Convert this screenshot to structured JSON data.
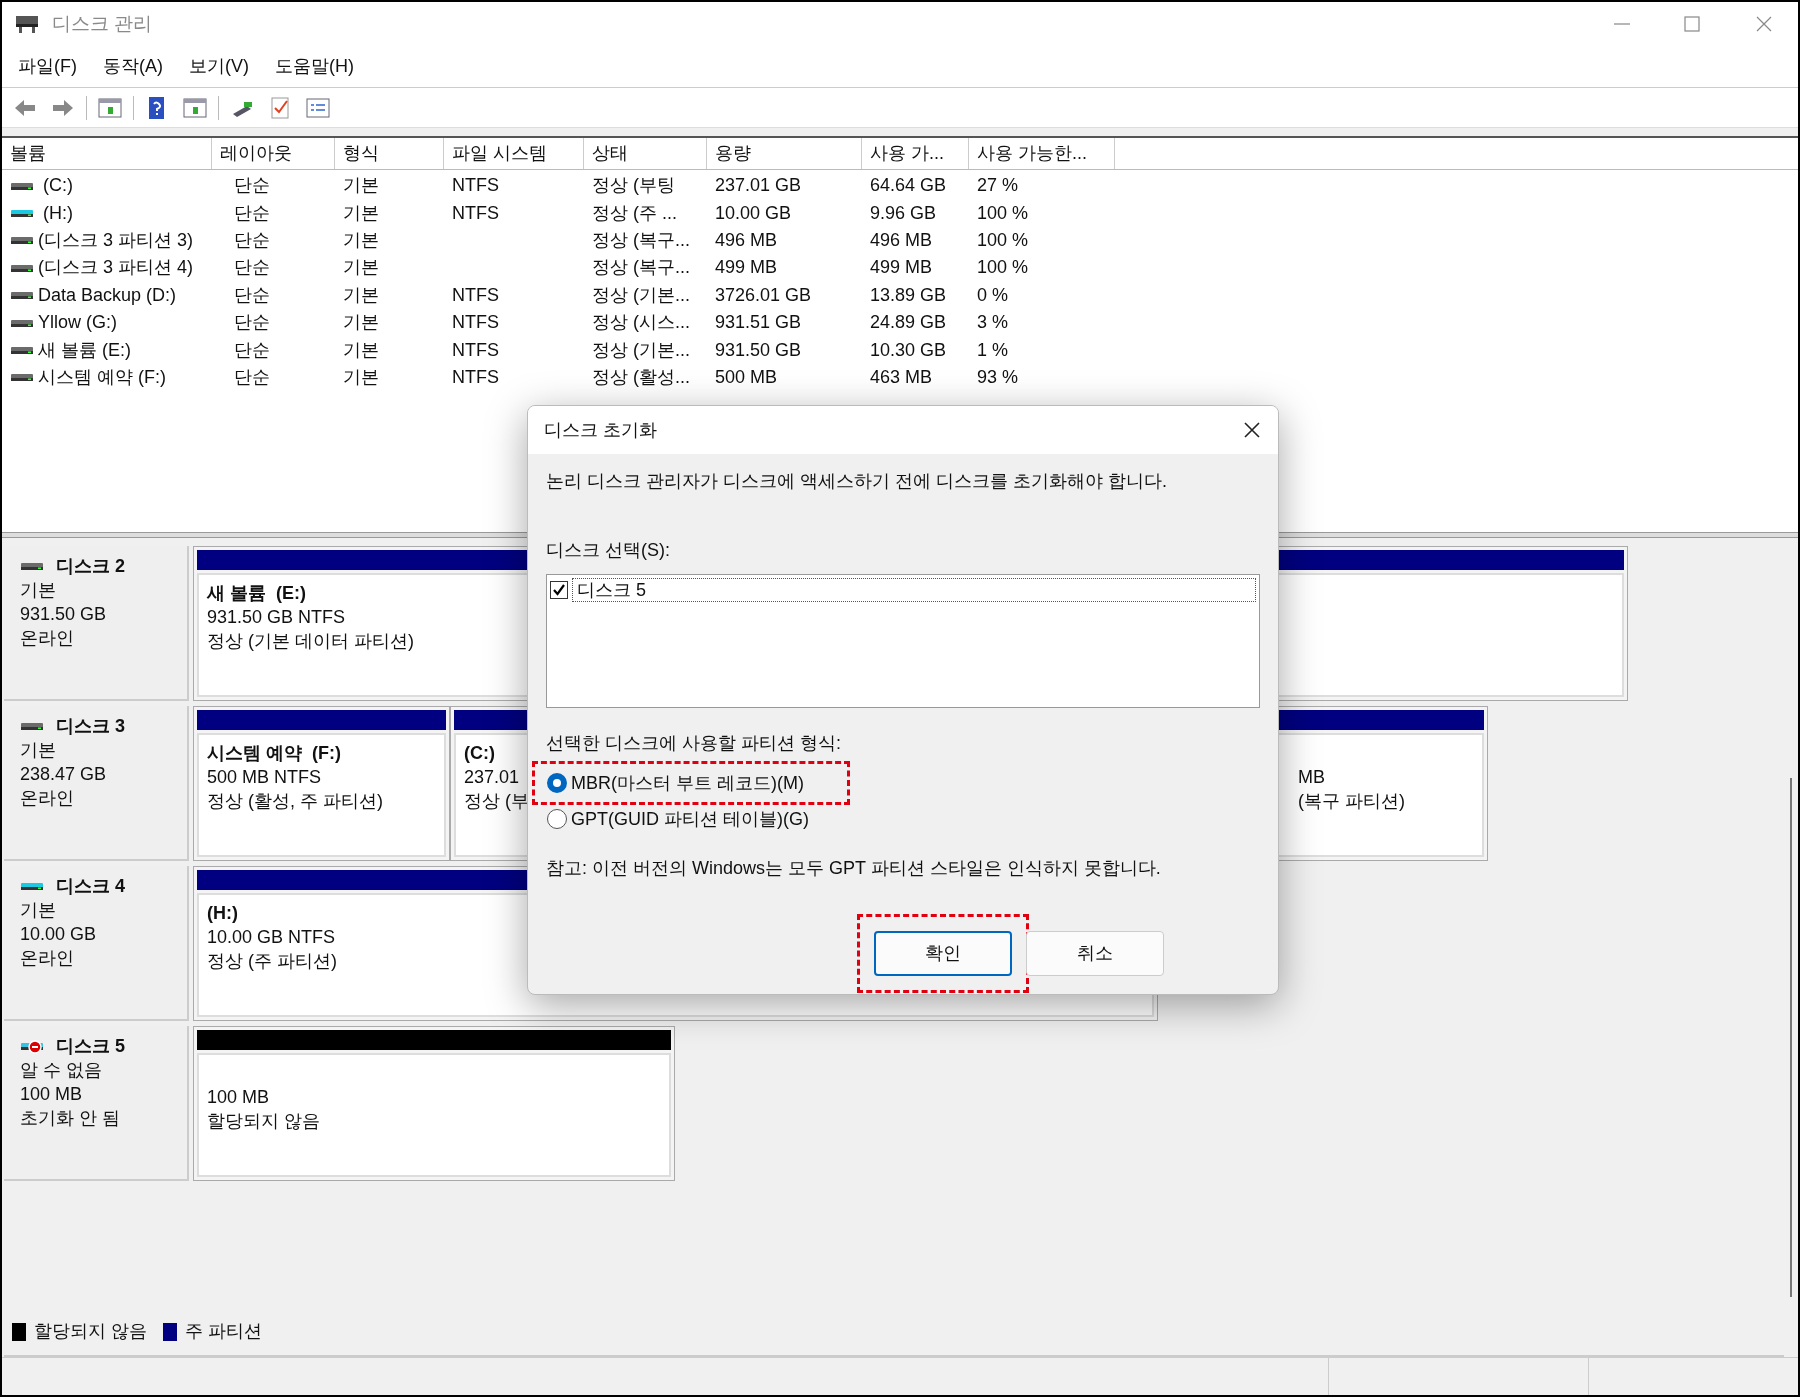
{
  "window": {
    "title": "디스크 관리"
  },
  "menu": [
    "파일(F)",
    "동작(A)",
    "보기(V)",
    "도움말(H)"
  ],
  "volume_table": {
    "columns": [
      "볼륨",
      "레이아웃",
      "형식",
      "파일 시스템",
      "상태",
      "용량",
      "사용 가...",
      "사용 가능한..."
    ],
    "rows": [
      {
        "kind": "fixed",
        "cells": [
          " (C:)",
          "단순",
          "기본",
          "NTFS",
          "정상 (부팅",
          "237.01 GB",
          "64.64 GB",
          "27 %"
        ]
      },
      {
        "kind": "removable",
        "cells": [
          " (H:)",
          "단순",
          "기본",
          "NTFS",
          "정상 (주 ...",
          "10.00 GB",
          "9.96 GB",
          "100 %"
        ]
      },
      {
        "kind": "fixed",
        "cells": [
          "(디스크 3 파티션 3)",
          "단순",
          "기본",
          "",
          "정상 (복구...",
          "496 MB",
          "496 MB",
          "100 %"
        ]
      },
      {
        "kind": "fixed",
        "cells": [
          "(디스크 3 파티션 4)",
          "단순",
          "기본",
          "",
          "정상 (복구...",
          "499 MB",
          "499 MB",
          "100 %"
        ]
      },
      {
        "kind": "fixed",
        "cells": [
          "Data Backup (D:)",
          "단순",
          "기본",
          "NTFS",
          "정상 (기본...",
          "3726.01 GB",
          "13.89 GB",
          "0 %"
        ]
      },
      {
        "kind": "fixed",
        "cells": [
          "Yllow (G:)",
          "단순",
          "기본",
          "NTFS",
          "정상 (시스...",
          "931.51 GB",
          "24.89 GB",
          "3 %"
        ]
      },
      {
        "kind": "fixed",
        "cells": [
          "새 볼륨 (E:)",
          "단순",
          "기본",
          "NTFS",
          "정상 (기본...",
          "931.50 GB",
          "10.30 GB",
          "1 %"
        ]
      },
      {
        "kind": "fixed",
        "cells": [
          "시스템 예약 (F:)",
          "단순",
          "기본",
          "NTFS",
          "정상 (활성...",
          "500 MB",
          "463 MB",
          "93 %"
        ]
      }
    ]
  },
  "disks": [
    {
      "kind": "fixed",
      "name": "디스크 2",
      "type": "기본",
      "size": "931.50 GB",
      "status": "온라인",
      "partitions": [
        {
          "color": "#000080",
          "name": "새 볼륨  (E:)",
          "size": "931.50 GB NTFS",
          "status": "정상 (기본 데이터 파티션)"
        }
      ]
    },
    {
      "kind": "fixed",
      "name": "디스크 3",
      "type": "기본",
      "size": "238.47 GB",
      "status": "온라인",
      "partitions": [
        {
          "color": "#000080",
          "name": "시스템 예약  (F:)",
          "size": "500 MB NTFS",
          "status": "정상 (활성, 주 파티션)"
        },
        {
          "color": "#000080",
          "name": "(C:)",
          "size": "237.01",
          "status": "정상 (부"
        },
        {
          "color": "#000080",
          "size": "MB",
          "status": "(복구 파티션)"
        }
      ]
    },
    {
      "kind": "removable",
      "name": "디스크 4",
      "type": "기본",
      "size": "10.00 GB",
      "status": "온라인",
      "partitions": [
        {
          "color": "#000080",
          "name": "(H:)",
          "size": "10.00 GB NTFS",
          "status": "정상 (주 파티션)"
        }
      ]
    },
    {
      "kind": "unknown",
      "name": "디스크 5",
      "type": "알 수 없음",
      "size": "100 MB",
      "status": "초기화 안 됨",
      "partitions": [
        {
          "color": "#000000",
          "size": "100 MB",
          "status": "할당되지 않음"
        }
      ]
    }
  ],
  "legend": [
    {
      "color": "#000000",
      "label": "할당되지 않음"
    },
    {
      "color": "#000080",
      "label": "주 파티션"
    }
  ],
  "dialog": {
    "title": "디스크 초기화",
    "message": "논리 디스크 관리자가 디스크에 액세스하기 전에 디스크를 초기화해야 합니다.",
    "disk_select_label": "디스크 선택(S):",
    "disk_list": [
      {
        "label": "디스크 5",
        "checked": true
      }
    ],
    "partition_style_label": "선택한 디스크에 사용할 파티션 형식:",
    "options": [
      {
        "label": "MBR(마스터 부트 레코드)(M)",
        "selected": true,
        "highlighted": true
      },
      {
        "label": "GPT(GUID 파티션 테이블)(G)",
        "selected": false,
        "highlighted": false
      }
    ],
    "note": "참고: 이전 버전의 Windows는 모두 GPT 파티션 스타일은 인식하지 못합니다.",
    "buttons": [
      {
        "label": "확인",
        "default": true,
        "highlighted": true
      },
      {
        "label": "취소",
        "default": false,
        "highlighted": false
      }
    ]
  }
}
